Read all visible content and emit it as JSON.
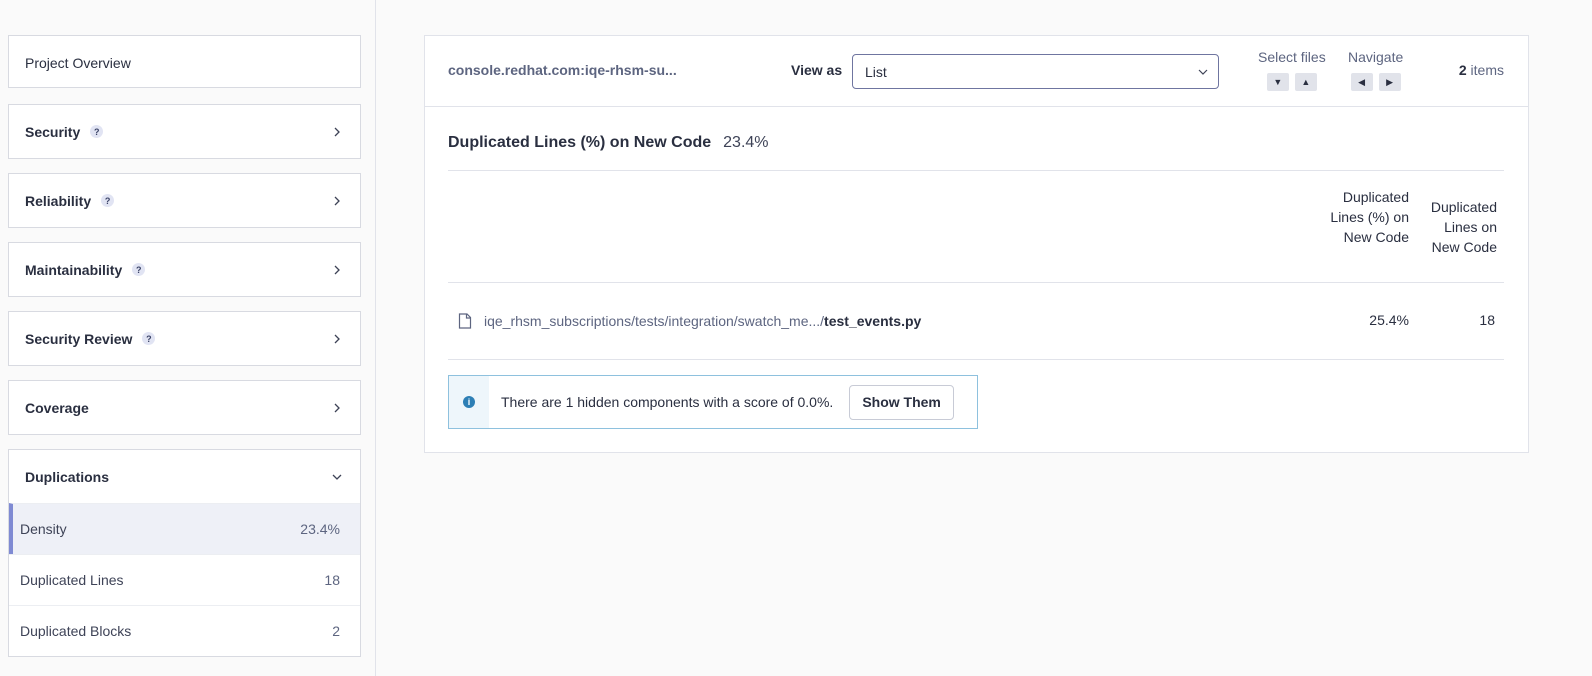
{
  "sidebar": {
    "overview": "Project Overview",
    "sections": [
      {
        "label": "Security",
        "help": "?"
      },
      {
        "label": "Reliability",
        "help": "?"
      },
      {
        "label": "Maintainability",
        "help": "?"
      },
      {
        "label": "Security Review",
        "help": "?"
      },
      {
        "label": "Coverage"
      }
    ],
    "duplications": {
      "label": "Duplications",
      "items": [
        {
          "label": "Density",
          "value": "23.4%"
        },
        {
          "label": "Duplicated Lines",
          "value": "18"
        },
        {
          "label": "Duplicated Blocks",
          "value": "2"
        }
      ]
    }
  },
  "toolbar": {
    "breadcrumb": "console.redhat.com:iqe-rhsm-su...",
    "view_as_label": "View as",
    "view_as_value": "List",
    "select_files_label": "Select files",
    "navigate_label": "Navigate",
    "count_number": "2",
    "count_suffix": "items"
  },
  "metric": {
    "title": "Duplicated Lines (%) on New Code",
    "value": "23.4%"
  },
  "table": {
    "col1": "Duplicated Lines (%) on New Code",
    "col2": "Duplicated Lines on New Code",
    "rows": [
      {
        "path": "iqe_rhsm_subscriptions/tests/integration/swatch_me.../",
        "file": "test_events.py",
        "density": "25.4%",
        "lines": "18"
      }
    ]
  },
  "info": {
    "message": "There are 1 hidden components with a score of 0.0%.",
    "button": "Show Them"
  },
  "colors": {
    "accent": "#7f8ad3",
    "info_border": "#8ec1de",
    "info_icon": "#2d7fb5"
  }
}
